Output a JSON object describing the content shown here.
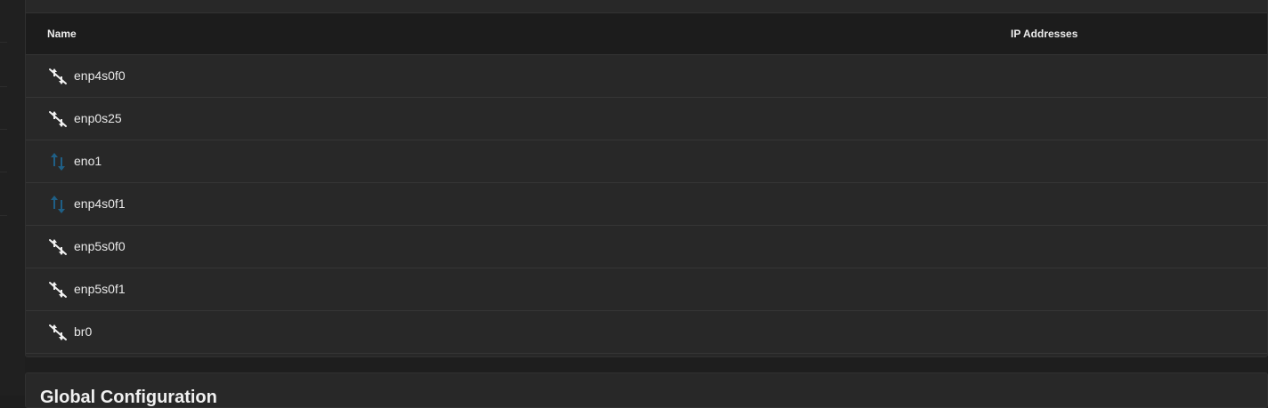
{
  "table": {
    "columns": {
      "name": "Name",
      "ip_addresses": "IP Addresses"
    },
    "rows": [
      {
        "name": "enp4s0f0",
        "status": "down",
        "icon": "link-down-icon",
        "ip": ""
      },
      {
        "name": "enp0s25",
        "status": "down",
        "icon": "link-down-icon",
        "ip": ""
      },
      {
        "name": "eno1",
        "status": "up",
        "icon": "link-up-icon",
        "ip": ""
      },
      {
        "name": "enp4s0f1",
        "status": "up",
        "icon": "link-up-icon",
        "ip": ""
      },
      {
        "name": "enp5s0f0",
        "status": "down",
        "icon": "link-down-icon",
        "ip": ""
      },
      {
        "name": "enp5s0f1",
        "status": "down",
        "icon": "link-down-icon",
        "ip": ""
      },
      {
        "name": "br0",
        "status": "down",
        "icon": "link-down-icon",
        "ip": ""
      }
    ]
  },
  "global_configuration": {
    "title": "Global Configuration"
  },
  "colors": {
    "link_up": "#1f5f86",
    "link_down": "#f0f0f0",
    "background": "#1e1e1e",
    "card": "#282828",
    "header": "#1c1c1c"
  }
}
